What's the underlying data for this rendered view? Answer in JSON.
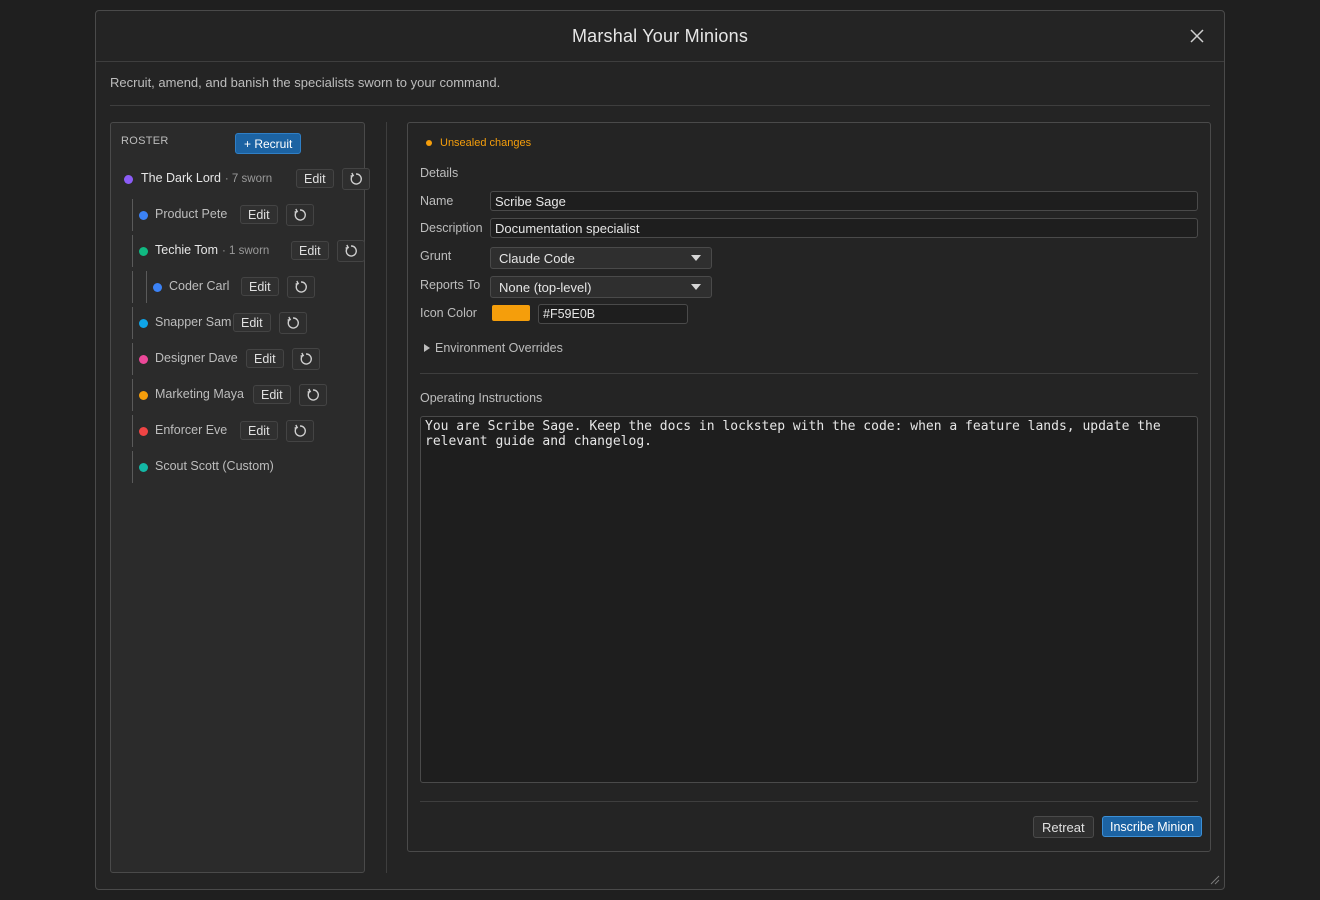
{
  "dialog": {
    "title": "Marshal Your Minions",
    "subtitle": "Recruit, amend, and banish the specialists sworn to your command."
  },
  "roster": {
    "heading": "ROSTER",
    "recruit_label": "+ Recruit",
    "edit_label": "Edit",
    "items": [
      {
        "name": "The Dark Lord",
        "meta": "· 7 sworn",
        "color": "#8b5cf6",
        "depth": 0,
        "strong": true,
        "editable": true
      },
      {
        "name": "Product Pete",
        "meta": "",
        "color": "#3b82f6",
        "depth": 1,
        "strong": false,
        "editable": true
      },
      {
        "name": "Techie Tom",
        "meta": "· 1 sworn",
        "color": "#10b981",
        "depth": 1,
        "strong": true,
        "editable": true
      },
      {
        "name": "Coder Carl",
        "meta": "",
        "color": "#3b82f6",
        "depth": 2,
        "strong": false,
        "editable": true
      },
      {
        "name": "Snapper Sam",
        "meta": "",
        "color": "#0ea5e9",
        "depth": 1,
        "strong": false,
        "editable": true
      },
      {
        "name": "Designer Dave",
        "meta": "",
        "color": "#ec4899",
        "depth": 1,
        "strong": false,
        "editable": true
      },
      {
        "name": "Marketing Maya",
        "meta": "",
        "color": "#f59e0b",
        "depth": 1,
        "strong": false,
        "editable": true
      },
      {
        "name": "Enforcer Eve",
        "meta": "",
        "color": "#ef4444",
        "depth": 1,
        "strong": false,
        "editable": true
      },
      {
        "name": "Scout Scott (Custom)",
        "meta": "",
        "color": "#14b8a6",
        "depth": 1,
        "strong": false,
        "editable": false
      }
    ]
  },
  "editor": {
    "status": "Unsealed changes",
    "status_color": "#f59e0b",
    "details_heading": "Details",
    "name_label": "Name",
    "name_value": "Scribe Sage",
    "description_label": "Description",
    "description_value": "Documentation specialist",
    "grunt_label": "Grunt",
    "grunt_value": "Claude Code",
    "reports_label": "Reports To",
    "reports_value": "None (top-level)",
    "icon_color_label": "Icon Color",
    "icon_color_value": "#F59E0B",
    "env_overrides_label": "Environment Overrides",
    "instructions_heading": "Operating Instructions",
    "instructions_text": "You are Scribe Sage. Keep the docs in lockstep with the code: when a feature lands, update the\nrelevant guide and changelog.",
    "retreat_label": "Retreat",
    "inscribe_label": "Inscribe Minion"
  },
  "colors": {
    "accent": "#1c63a3",
    "background": "#242424"
  }
}
